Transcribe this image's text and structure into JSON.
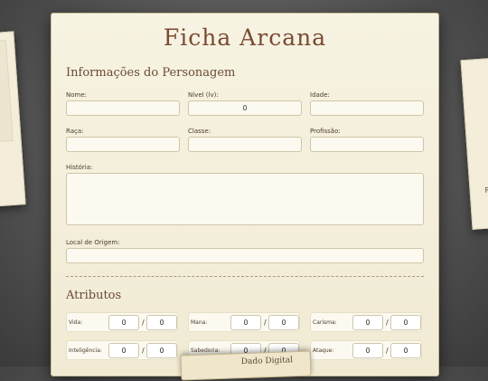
{
  "sheet": {
    "title": "Ficha Arcana"
  },
  "char_section": {
    "title": "Informações do Personagem"
  },
  "fields": {
    "nome": {
      "label": "Nome:",
      "value": ""
    },
    "nivel": {
      "label": "Nível (lv):",
      "value": "0"
    },
    "idade": {
      "label": "Idade:",
      "value": ""
    },
    "raca": {
      "label": "Raça:",
      "value": ""
    },
    "classe": {
      "label": "Classe:",
      "value": ""
    },
    "profissao": {
      "label": "Profissão:",
      "value": ""
    },
    "historia": {
      "label": "História:",
      "value": ""
    },
    "origem": {
      "label": "Local de Origem:",
      "value": ""
    }
  },
  "attr_section": {
    "title": "Atributos"
  },
  "attributes": [
    {
      "label": "Vida:",
      "current": "0",
      "max": "0"
    },
    {
      "label": "Mana:",
      "current": "0",
      "max": "0"
    },
    {
      "label": "Carisma:",
      "current": "0",
      "max": "0"
    },
    {
      "label": "Inteligência:",
      "current": "0",
      "max": "0"
    },
    {
      "label": "Sabedoria:",
      "current": "0",
      "max": "0"
    },
    {
      "label": "Ataque:",
      "current": "0",
      "max": "0"
    }
  ],
  "attr_separator": "/",
  "dice_card": {
    "label": "Dado Digital"
  },
  "right_card": {
    "text": "Re"
  }
}
